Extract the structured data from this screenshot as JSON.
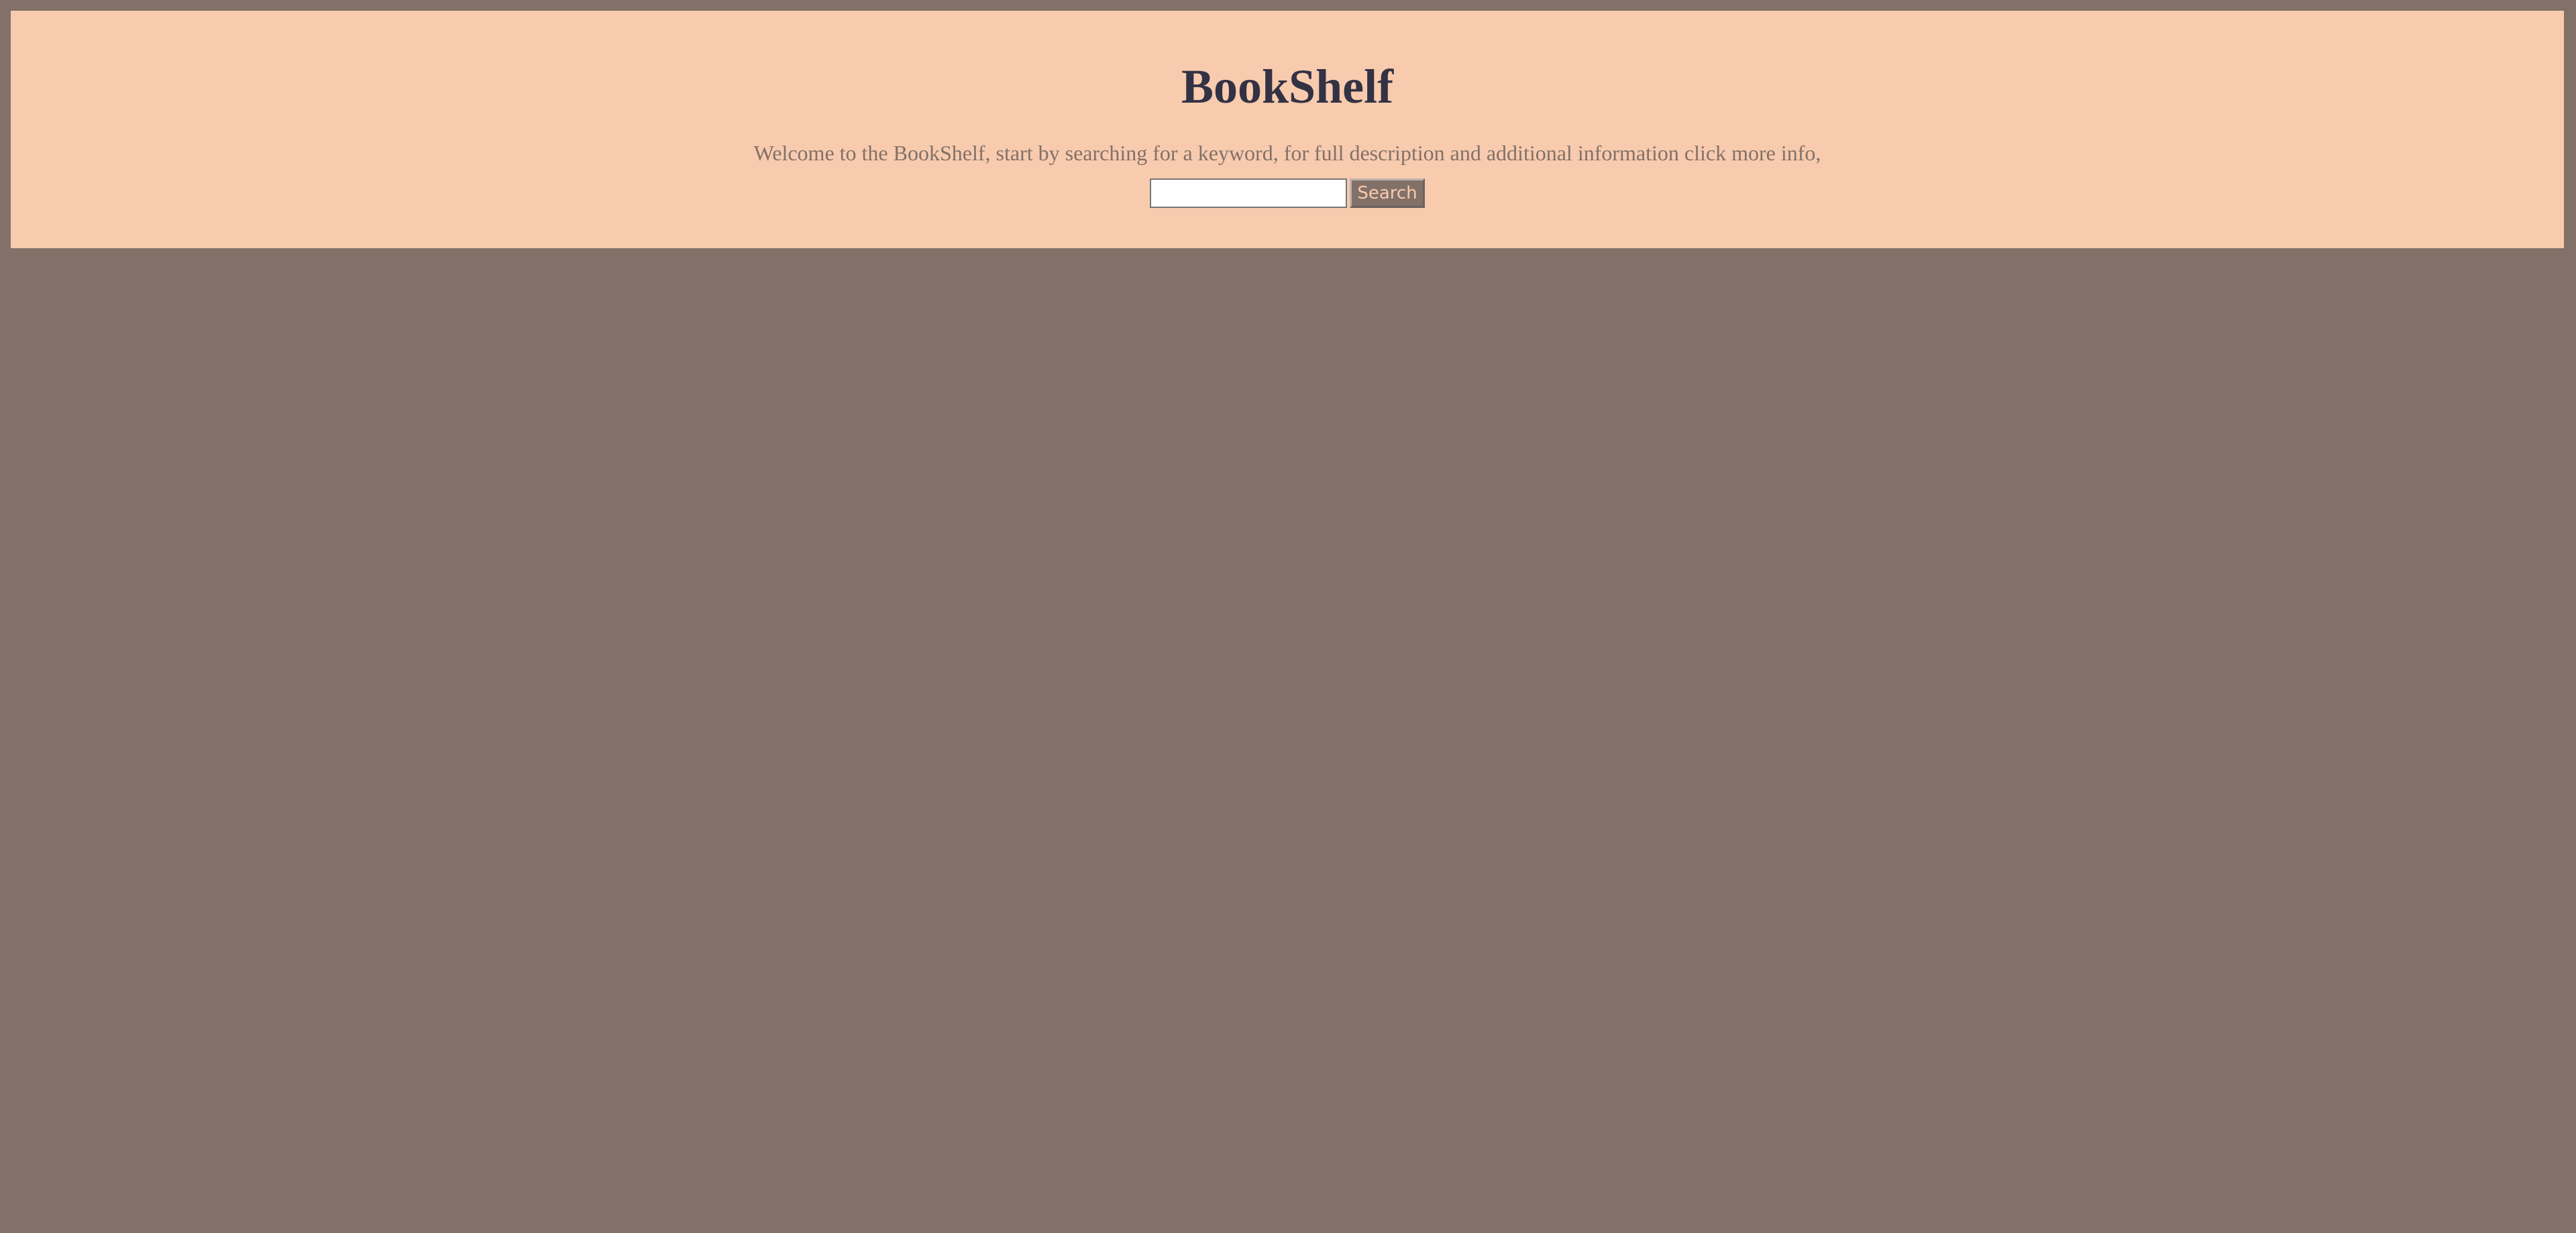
{
  "header": {
    "title": "BookShelf",
    "welcome": "Welcome to the BookShelf, start by searching for a keyword, for full description and additional information click more info,"
  },
  "search": {
    "value": "",
    "placeholder": "",
    "button_label": "Search"
  },
  "colors": {
    "page_background": "#827168",
    "header_background": "#f8cbae",
    "title_color": "#333244",
    "welcome_text_color": "#827168",
    "button_background": "#827168",
    "button_text_color": "#f8cbae"
  }
}
